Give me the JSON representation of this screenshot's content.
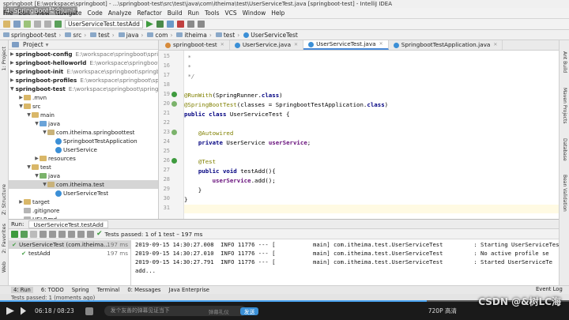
{
  "window": {
    "title": "springboot [E:\\workspace\\springboot] - ...\\springboot-test\\src\\test\\java\\com\\itheima\\test\\UserServiceTest.java [springboot-test] - IntelliJ IDEA",
    "video_overlay_title": "4. SpringBoot整合Junit"
  },
  "menu": [
    "File",
    "Edit",
    "View",
    "Navigate",
    "Code",
    "Analyze",
    "Refactor",
    "Build",
    "Run",
    "Tools",
    "VCS",
    "Window",
    "Help"
  ],
  "toolbar": {
    "run_config": "UserServiceTest.testAdd"
  },
  "breadcrumbs": [
    "springboot-test",
    "src",
    "test",
    "java",
    "com",
    "itheima",
    "test",
    "UserServiceTest"
  ],
  "project_panel": {
    "title": "Project",
    "items": [
      {
        "label": "springboot-config",
        "path": "E:\\workspace\\springboot\\springboot-config",
        "kind": "module",
        "bold": true,
        "depth": 0,
        "arrow": "▶"
      },
      {
        "label": "springboot-helloworld",
        "path": "E:\\workspace\\springboot\\springboot-helloworld",
        "kind": "module",
        "bold": true,
        "depth": 0,
        "arrow": "▶"
      },
      {
        "label": "springboot-init",
        "path": "E:\\workspace\\springboot\\springboot-init",
        "kind": "module",
        "bold": true,
        "depth": 0,
        "arrow": "▶"
      },
      {
        "label": "springboot-profiles",
        "path": "E:\\workspace\\springboot\\springboot-profiles",
        "kind": "module",
        "bold": true,
        "depth": 0,
        "arrow": "▶"
      },
      {
        "label": "springboot-test",
        "path": "E:\\workspace\\springboot\\springboot-test",
        "kind": "module",
        "bold": true,
        "depth": 0,
        "arrow": "▼"
      },
      {
        "label": ".mvn",
        "path": "",
        "kind": "folder",
        "bold": false,
        "depth": 1,
        "arrow": "▶"
      },
      {
        "label": "src",
        "path": "",
        "kind": "folder",
        "bold": false,
        "depth": 1,
        "arrow": "▼"
      },
      {
        "label": "main",
        "path": "",
        "kind": "folder",
        "bold": false,
        "depth": 2,
        "arrow": "▼"
      },
      {
        "label": "java",
        "path": "",
        "kind": "src",
        "bold": false,
        "depth": 3,
        "arrow": "▼"
      },
      {
        "label": "com.itheima.springboottest",
        "path": "",
        "kind": "pkg",
        "bold": false,
        "depth": 4,
        "arrow": "▼"
      },
      {
        "label": "SpringbootTestApplication",
        "path": "",
        "kind": "cls",
        "bold": false,
        "depth": 5,
        "arrow": ""
      },
      {
        "label": "UserService",
        "path": "",
        "kind": "cls",
        "bold": false,
        "depth": 5,
        "arrow": ""
      },
      {
        "label": "resources",
        "path": "",
        "kind": "folder",
        "bold": false,
        "depth": 3,
        "arrow": "▶"
      },
      {
        "label": "test",
        "path": "",
        "kind": "folder",
        "bold": false,
        "depth": 2,
        "arrow": "▼"
      },
      {
        "label": "java",
        "path": "",
        "kind": "test",
        "bold": false,
        "depth": 3,
        "arrow": "▼"
      },
      {
        "label": "com.itheima.test",
        "path": "",
        "kind": "pkg",
        "bold": false,
        "depth": 4,
        "arrow": "▼",
        "selected": true
      },
      {
        "label": "UserServiceTest",
        "path": "",
        "kind": "cls",
        "bold": false,
        "depth": 5,
        "arrow": ""
      },
      {
        "label": "target",
        "path": "",
        "kind": "folder",
        "bold": false,
        "depth": 1,
        "arrow": "▶"
      },
      {
        "label": ".gitignore",
        "path": "",
        "kind": "file",
        "bold": false,
        "depth": 1,
        "arrow": ""
      },
      {
        "label": "HELP.md",
        "path": "",
        "kind": "file",
        "bold": false,
        "depth": 1,
        "arrow": ""
      }
    ]
  },
  "editor_tabs": [
    {
      "label": "springboot-test",
      "active": false,
      "color": "#d68a3b"
    },
    {
      "label": "UserService.java",
      "active": false,
      "color": "#3b8fd6"
    },
    {
      "label": "UserServiceTest.java",
      "active": true,
      "color": "#3b8fd6"
    },
    {
      "label": "SpringbootTestApplication.java",
      "active": false,
      "color": "#3b8fd6"
    }
  ],
  "code_lines": [
    {
      "n": "15",
      "html": "<span class='cm'> *</span>"
    },
    {
      "n": "16",
      "html": "<span class='cm'> *</span>"
    },
    {
      "n": "17",
      "html": "<span class='cm'> */</span>"
    },
    {
      "n": "18",
      "html": ""
    },
    {
      "n": "19",
      "html": "<span class='ann'>@RunWith</span>(SpringRunner.<span class='kw'>class</span>)"
    },
    {
      "n": "20",
      "html": "<span class='ann'>@SpringBootTest</span>(classes = SpringbootTestApplication.<span class='kw'>class</span>)"
    },
    {
      "n": "21",
      "html": "<span class='kw'>public class</span> UserServiceTest {"
    },
    {
      "n": "22",
      "html": ""
    },
    {
      "n": "23",
      "html": "    <span class='ann'>@Autowired</span>"
    },
    {
      "n": "24",
      "html": "    <span class='kw'>private</span> UserService <span class='fld'>userService</span>;"
    },
    {
      "n": "25",
      "html": ""
    },
    {
      "n": "26",
      "html": "    <span class='ann'>@Test</span>"
    },
    {
      "n": "27",
      "html": "    <span class='kw'>public void</span> testAdd(){"
    },
    {
      "n": "28",
      "html": "        <span class='fld'>userService</span>.add();"
    },
    {
      "n": "29",
      "html": "    }"
    },
    {
      "n": "30",
      "html": "}"
    },
    {
      "n": "31",
      "html": ""
    }
  ],
  "run_panel": {
    "label": "Run:",
    "tab": "UserServiceTest.testAdd",
    "status": "Tests passed: 1 of 1 test – 197 ms",
    "tree": [
      {
        "label": "UserServiceTest (com.itheima...",
        "time": "197 ms",
        "depth": 0
      },
      {
        "label": "testAdd",
        "time": "197 ms",
        "depth": 1
      }
    ],
    "console": [
      "2019-09-15 14:30:27.008  INFO 11776 --- [           main] com.itheima.test.UserServiceTest         : Starting UserServiceTes",
      "2019-09-15 14:30:27.010  INFO 11776 --- [           main] com.itheima.test.UserServiceTest         : No active profile se",
      "2019-09-15 14:30:27.791  INFO 11776 --- [           main] com.itheima.test.UserServiceTest         : Started UserServiceTe",
      "add..."
    ]
  },
  "bottom_tabs": [
    "4: Run",
    "6: TODO",
    "Spring",
    "Terminal",
    "0: Messages",
    "Java Enterprise"
  ],
  "event_log": "Event Log",
  "status_text": "Tests passed: 1 (moments ago)",
  "side_tabs_left": [
    "1: Project",
    "Z: Structure",
    "2: Favorites",
    "Web"
  ],
  "side_tabs_right": [
    "Ant Build",
    "Maven Projects",
    "Database",
    "Bean Validation"
  ],
  "video": {
    "time_current": "06:18",
    "time_total": "08:23",
    "danmaku_placeholder": "发个友善的弹幕见证当下",
    "danmaku_button": "弹幕礼仪",
    "send": "发送",
    "quality": "720P 高清",
    "watermark": "CSDN @&树LC海",
    "progress": 0.75
  }
}
